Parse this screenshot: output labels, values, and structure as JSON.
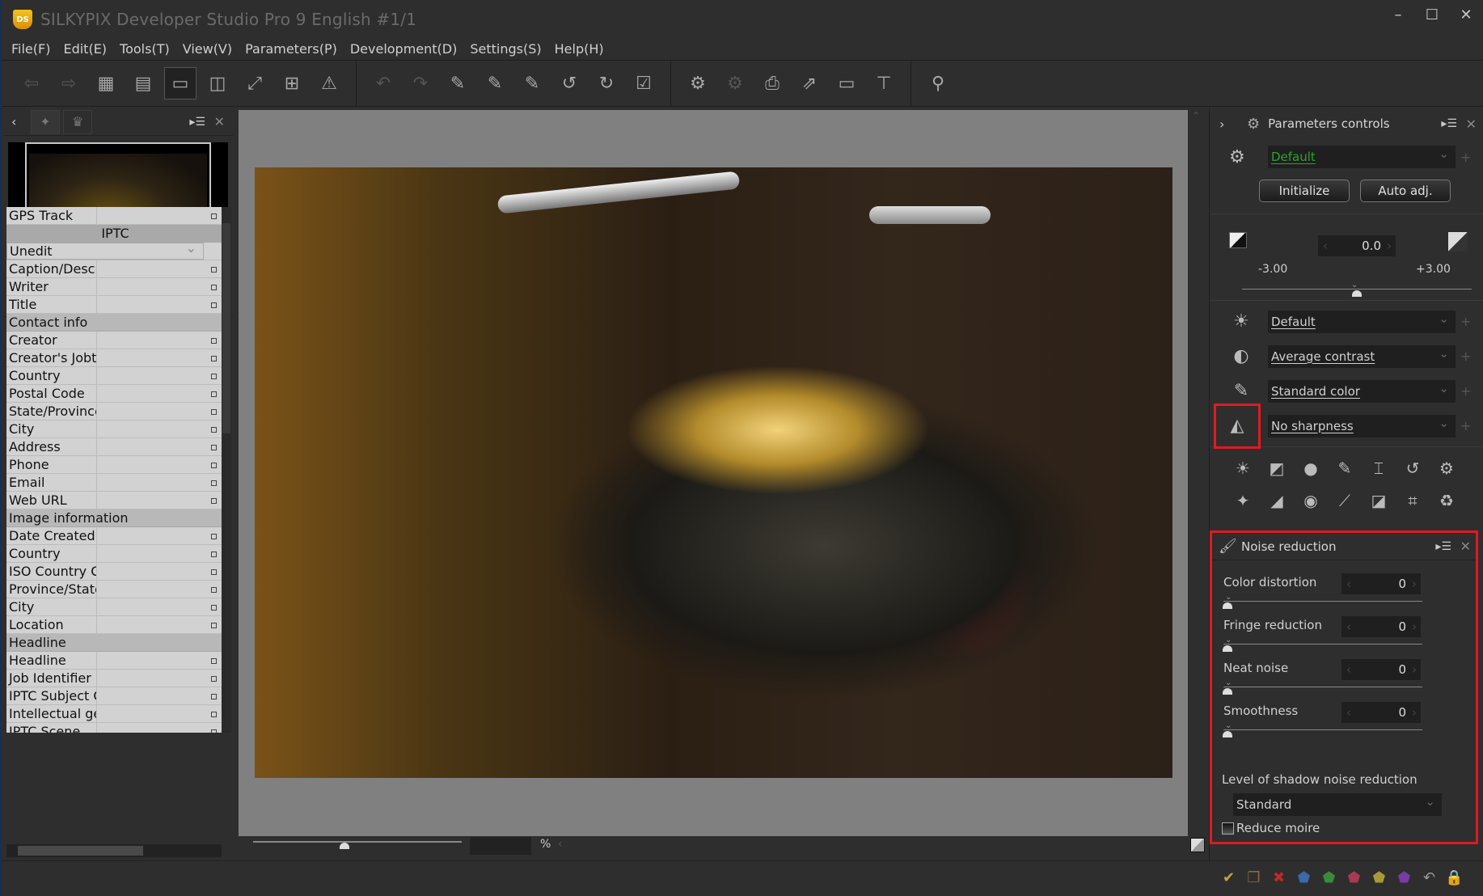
{
  "window": {
    "logo": "DS",
    "title": "SILKYPIX Developer Studio Pro 9 English   #1/1",
    "controls": [
      "minimize",
      "maximize",
      "close"
    ]
  },
  "menu": [
    "File(F)",
    "Edit(E)",
    "Tools(T)",
    "View(V)",
    "Parameters(P)",
    "Development(D)",
    "Settings(S)",
    "Help(H)"
  ],
  "toolbar": {
    "view_group": [
      {
        "icon": "previous-photo-icon",
        "glyph": "⇦",
        "disabled": true
      },
      {
        "icon": "next-photo-icon",
        "glyph": "⇨",
        "disabled": true
      },
      {
        "icon": "thumbnail-grid-icon",
        "glyph": "▦"
      },
      {
        "icon": "thumbnail-preview-icon",
        "glyph": "▤"
      },
      {
        "icon": "single-preview-icon",
        "glyph": "▭",
        "active": true
      },
      {
        "icon": "compare-icon",
        "glyph": "◫"
      },
      {
        "icon": "fullscreen-icon",
        "glyph": "⤢"
      },
      {
        "icon": "grid-icon",
        "glyph": "⊞"
      },
      {
        "icon": "warning-icon",
        "glyph": "⚠"
      }
    ],
    "edit_group": [
      {
        "icon": "undo-icon",
        "glyph": "↶",
        "disabled": true
      },
      {
        "icon": "redo-icon",
        "glyph": "↷",
        "disabled": true
      },
      {
        "icon": "gray-balance-eyedropper-icon",
        "glyph": "✎"
      },
      {
        "icon": "white-balance-eyedropper-icon",
        "glyph": "✎"
      },
      {
        "icon": "highlight-eyedropper-icon",
        "glyph": "✎"
      },
      {
        "icon": "rotate-left-icon",
        "glyph": "↺"
      },
      {
        "icon": "rotate-right-icon",
        "glyph": "↻"
      },
      {
        "icon": "mark-icon",
        "glyph": "☑"
      }
    ],
    "output_group": [
      {
        "icon": "develop-save-icon",
        "glyph": "⚙"
      },
      {
        "icon": "batch-develop-icon",
        "glyph": "⚙",
        "disabled": true
      },
      {
        "icon": "print-icon",
        "glyph": "⎙"
      },
      {
        "icon": "export-icon",
        "glyph": "⇗"
      },
      {
        "icon": "monitor-icon",
        "glyph": "▭"
      },
      {
        "icon": "tools-icon",
        "glyph": "⊤"
      }
    ],
    "search_group": [
      {
        "icon": "search-icon",
        "glyph": "⚲"
      }
    ]
  },
  "left_top_panel": {
    "tabs": [
      "navigator-tab",
      "histogram-tab"
    ]
  },
  "left_bottom_panel": {
    "tabs": [
      "folder-tab",
      "info-tab"
    ],
    "rows": [
      {
        "type": "row",
        "label": "GPS Track"
      },
      {
        "type": "section-center",
        "label": "IPTC"
      },
      {
        "type": "select",
        "label": "Unedit"
      },
      {
        "type": "row",
        "label": "Caption/Descr"
      },
      {
        "type": "row",
        "label": "Writer"
      },
      {
        "type": "row",
        "label": "Title"
      },
      {
        "type": "section",
        "label": "Contact info"
      },
      {
        "type": "row",
        "label": "Creator"
      },
      {
        "type": "row",
        "label": "Creator's Jobti"
      },
      {
        "type": "row",
        "label": "Country"
      },
      {
        "type": "row",
        "label": "Postal Code"
      },
      {
        "type": "row",
        "label": "State/Province"
      },
      {
        "type": "row",
        "label": "City"
      },
      {
        "type": "row",
        "label": "Address"
      },
      {
        "type": "row",
        "label": "Phone"
      },
      {
        "type": "row",
        "label": "Email"
      },
      {
        "type": "row",
        "label": "Web URL"
      },
      {
        "type": "section",
        "label": "Image information"
      },
      {
        "type": "row",
        "label": "Date Created"
      },
      {
        "type": "row",
        "label": "Country"
      },
      {
        "type": "row",
        "label": "ISO Country C"
      },
      {
        "type": "row",
        "label": "Province/State"
      },
      {
        "type": "row",
        "label": "City"
      },
      {
        "type": "row",
        "label": "Location"
      },
      {
        "type": "section",
        "label": "Headline"
      },
      {
        "type": "row",
        "label": "Headline"
      },
      {
        "type": "row",
        "label": "Job Identifier"
      },
      {
        "type": "row",
        "label": "IPTC Subject C"
      },
      {
        "type": "row",
        "label": "Intellectual ge"
      },
      {
        "type": "row",
        "label": "IPTC Scene"
      }
    ]
  },
  "preview": {
    "zoom_value": "",
    "zoom_unit": "%"
  },
  "params": {
    "title": "Parameters controls",
    "preset": "Default",
    "initialize": "Initialize",
    "auto_adj": "Auto adj.",
    "exposure": {
      "value": "0.0",
      "min": "-3.00",
      "max": "+3.00"
    },
    "white_balance": "Default",
    "tone": "Average contrast",
    "color": "Standard color",
    "sharpness": "No sharpness",
    "tools_row1": [
      {
        "icon": "exposure-bias-icon",
        "glyph": "☀"
      },
      {
        "icon": "tone-curve-icon",
        "glyph": "◩"
      },
      {
        "icon": "color-correction-icon",
        "glyph": "●"
      },
      {
        "icon": "white-balance-adjust-icon",
        "glyph": "✎"
      },
      {
        "icon": "lens-distortion-icon",
        "glyph": "⌶"
      },
      {
        "icon": "rotation-icon",
        "glyph": "↺"
      },
      {
        "icon": "develop-settings-icon",
        "glyph": "⚙"
      }
    ],
    "tools_row2": [
      {
        "icon": "highlight-control-icon",
        "glyph": "✦"
      },
      {
        "icon": "dynamic-range-icon",
        "glyph": "◢"
      },
      {
        "icon": "fisheye-icon",
        "glyph": "◉"
      },
      {
        "icon": "brush-icon",
        "glyph": "⟋"
      },
      {
        "icon": "partial-correction-icon",
        "glyph": "◪"
      },
      {
        "icon": "crop-icon",
        "glyph": "⌗"
      },
      {
        "icon": "recycle-icon",
        "glyph": "♻"
      }
    ]
  },
  "noise_reduction": {
    "title": "Noise reduction",
    "items": [
      {
        "label": "Color distortion",
        "value": "0"
      },
      {
        "label": "Fringe reduction",
        "value": "0"
      },
      {
        "label": "Neat noise",
        "value": "0"
      },
      {
        "label": "Smoothness",
        "value": "0"
      }
    ],
    "shadow_label": "Level of shadow noise reduction",
    "shadow_value": "Standard",
    "reduce_moire_label": "Reduce moire",
    "reduce_moire_checked": false
  },
  "status_icons": [
    {
      "name": "accept-icon",
      "glyph": "✔",
      "color": "#c9a23a"
    },
    {
      "name": "copy-icon",
      "glyph": "❐",
      "color": "#8a6a3a"
    },
    {
      "name": "reject-icon",
      "glyph": "✖",
      "color": "#c0282a"
    },
    {
      "name": "blue-tag-icon",
      "glyph": "⬟",
      "color": "#3a6aa8"
    },
    {
      "name": "green-tag-icon",
      "glyph": "⬟",
      "color": "#3a8a3a"
    },
    {
      "name": "red-tag-icon",
      "glyph": "⬟",
      "color": "#a83a55"
    },
    {
      "name": "yellow-tag-icon",
      "glyph": "⬟",
      "color": "#a89a3a"
    },
    {
      "name": "purple-tag-icon",
      "glyph": "⬟",
      "color": "#7a3aa8"
    },
    {
      "name": "revert-icon",
      "glyph": "↶",
      "color": "#999999"
    },
    {
      "name": "lock-icon",
      "glyph": "🔒",
      "color": "#a89060"
    }
  ],
  "colors": {
    "highlight": "#e01a22",
    "preset_active": "#2aa52a"
  }
}
